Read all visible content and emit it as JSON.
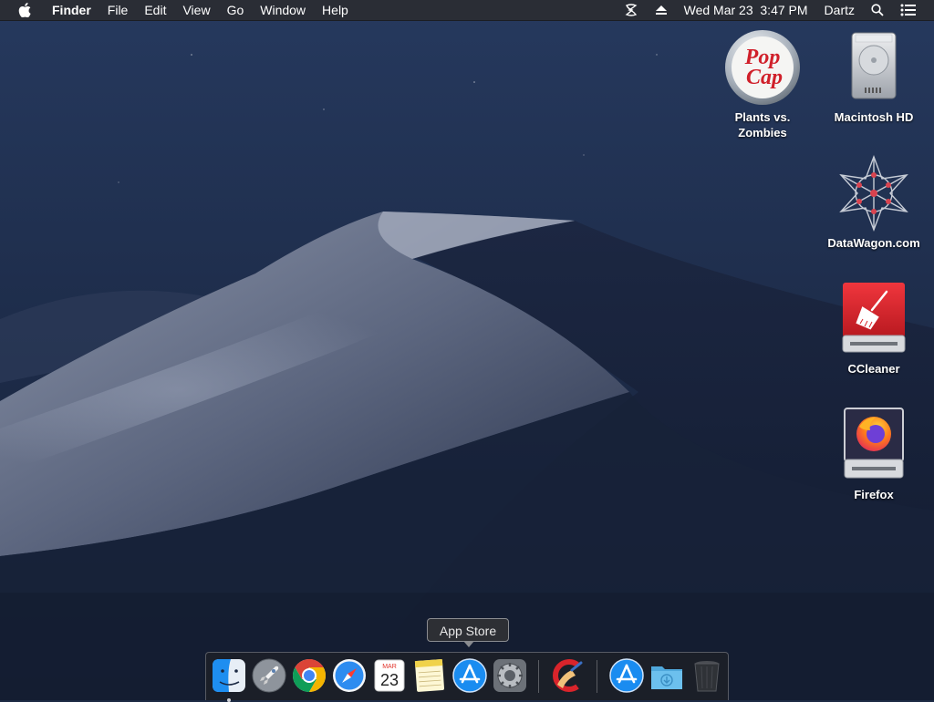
{
  "menubar": {
    "app_name": "Finder",
    "menus": [
      "File",
      "Edit",
      "View",
      "Go",
      "Window",
      "Help"
    ],
    "clock": "Wed Mar 23  3:47 PM",
    "user": "Dartz",
    "icons": [
      "apple-logo-icon",
      "status-swirl-icon",
      "eject-icon",
      "spotlight-search-icon",
      "notification-center-icon"
    ]
  },
  "desktop_icons": [
    {
      "name": "Plants vs. Zombies",
      "line1": "Plants vs.",
      "line2": "Zombies",
      "logo_text1": "Pop",
      "logo_text2": "Cap",
      "icon": "popcap-logo-icon"
    },
    {
      "name": "Macintosh HD",
      "icon": "hard-drive-icon"
    },
    {
      "name": "DataWagon.com",
      "icon": "network-star-icon"
    },
    {
      "name": "CCleaner",
      "icon": "ccleaner-drive-icon"
    },
    {
      "name": "Firefox",
      "icon": "firefox-drive-icon"
    }
  ],
  "tooltip": {
    "text": "App Store"
  },
  "dock": {
    "calendar_month": "MAR",
    "calendar_day": "23",
    "items": [
      "Finder",
      "Launchpad",
      "Google Chrome",
      "Safari",
      "Calendar",
      "Notes",
      "App Store",
      "System Preferences",
      "CCleaner",
      "App Store",
      "Downloads",
      "Trash"
    ],
    "running": [
      "Finder"
    ]
  },
  "colors": {
    "menubar_bg": "#2a2c32",
    "wallpaper_sky": "#1f2f4f",
    "ccleaner_red": "#d9242b",
    "appstore_blue": "#1a8cf0"
  }
}
